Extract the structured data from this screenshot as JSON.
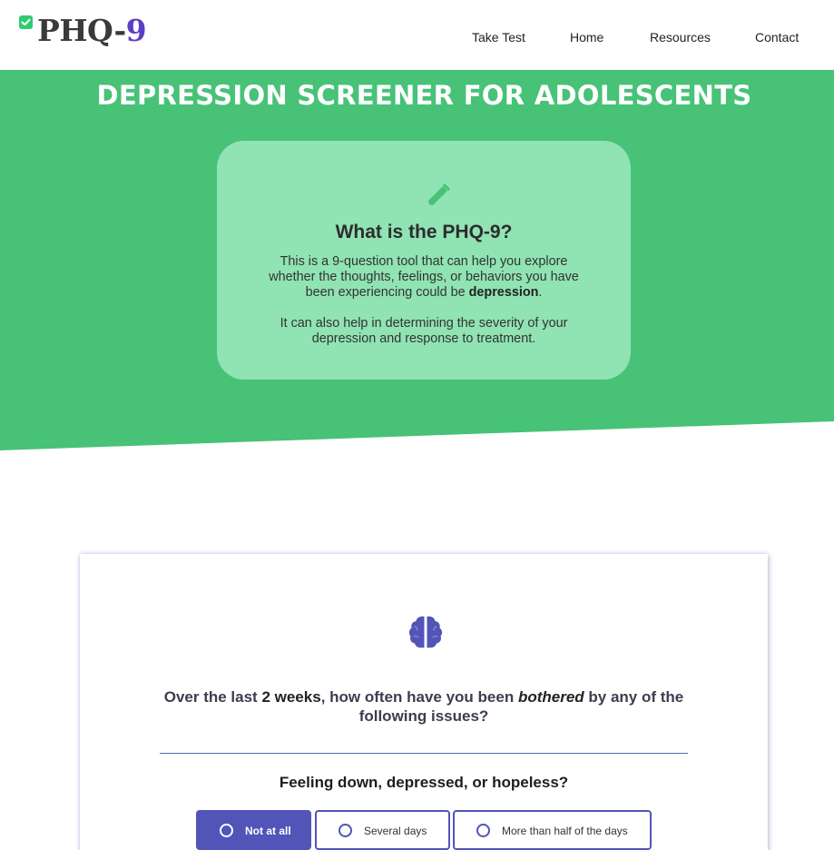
{
  "header": {
    "logo_main": "PHQ-",
    "logo_number": "9",
    "nav": [
      "Take Test",
      "Home",
      "Resources",
      "Contact"
    ]
  },
  "hero": {
    "title": "DEPRESSION SCREENER FOR ADOLESCENTS",
    "card": {
      "icon": "test-tube-icon",
      "title": "What is the PHQ-9?",
      "paragraph1": "This is a 9-question tool that can help you explore whether the thoughts, feelings, or behaviors you have been experiencing could be ",
      "paragraph1_bold": "depression",
      "paragraph1_end": ".",
      "paragraph2": "It can also help in determining the severity of your depression and response to treatment."
    }
  },
  "question": {
    "icon": "brain-icon",
    "intro_a": "Over the last ",
    "intro_em": "2 weeks",
    "intro_b": ", how often have you been ",
    "intro_italic": "bothered",
    "intro_c": " by any of the following issues?",
    "item": "Feeling down, depressed, or hopeless?",
    "options": [
      "Not at all",
      "Several days",
      "More than half of the days"
    ],
    "selected": "Not at all"
  },
  "colors": {
    "hero_green": "#47c277",
    "card_green": "#90e3b3",
    "accent_purple": "#5254b8",
    "logo_number": "#5b3fc7"
  }
}
